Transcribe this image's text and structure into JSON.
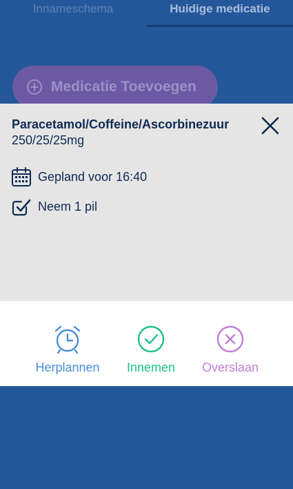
{
  "tabs": {
    "schedule_label": "Innameschema",
    "current_label": "Huidige medicatie"
  },
  "add_button_label": "Medicatie Toevoegen",
  "modal": {
    "medication_name": "Paracetamol/Coffeine/Ascorbinezuur",
    "dosage": "250/25/25mg",
    "planned_text": "Gepland voor 16:40",
    "take_text": "Neem 1 pil"
  },
  "actions": {
    "reschedule_label": "Herplannen",
    "take_label": "Innemen",
    "skip_label": "Overslaan"
  },
  "colors": {
    "background": "#24579a",
    "reschedule": "#4a8fd6",
    "take": "#1dbf8c",
    "skip": "#c27ed6",
    "text_dark": "#0f2a52"
  },
  "icons": {
    "close": "close-icon",
    "calendar": "calendar-icon",
    "checklist": "checkbox-check-icon",
    "alarm": "alarm-clock-icon",
    "take": "check-circle-icon",
    "skip": "x-circle-icon",
    "plus": "plus-circle-icon"
  }
}
